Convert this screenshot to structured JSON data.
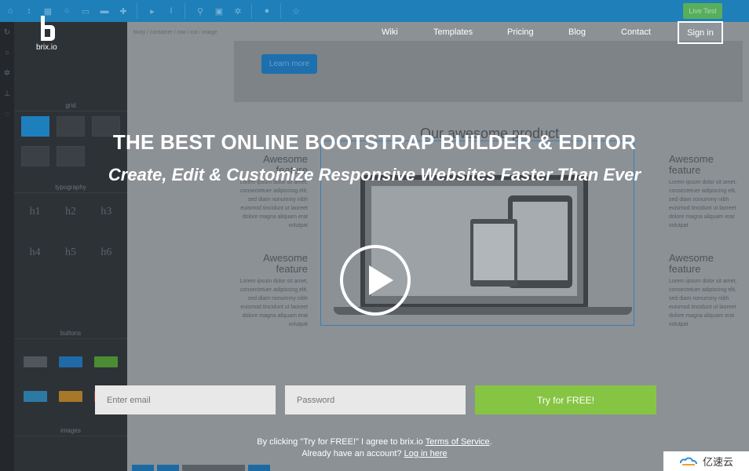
{
  "editor": {
    "toolbar_icons": [
      "home-icon",
      "arrows-icon",
      "grid-icon",
      "search-icon",
      "device-icon",
      "desktop-icon",
      "plus-icon",
      "pointer-icon",
      "text-icon",
      "zoom-icon",
      "image-icon",
      "gear-icon",
      "comment-icon",
      "star-icon"
    ],
    "live_test_label": "Live Test",
    "breadcrumb": "body / container / row / col / image",
    "learn_more_label": "Learn more",
    "product_title": "Our awesome product",
    "feature_heading": "Awesome feature",
    "feature_text": "Lorem ipsum dolor sit amet, consectetuer adipiscing elit, sed diam nonummy nibh euismod tincidunt ut laoreet dolore magna aliquam erat volutpat",
    "sidebar_sections": [
      "grid",
      "typography",
      "buttons",
      "images"
    ],
    "headings": [
      "h1",
      "h2",
      "h3",
      "h4",
      "h5",
      "h6"
    ]
  },
  "nav": {
    "logo_text": "brix.io",
    "links": [
      "Wiki",
      "Templates",
      "Pricing",
      "Blog",
      "Contact"
    ],
    "signin_label": "Sign in"
  },
  "hero": {
    "headline": "THE BEST ONLINE BOOTSTRAP BUILDER & EDITOR",
    "subheadline": "Create, Edit & Customize Responsive Websites Faster Than Ever"
  },
  "signup": {
    "email_placeholder": "Enter email",
    "password_placeholder": "Password",
    "cta_label": "Try for FREE!",
    "terms_prefix": "By clicking \"Try for FREE!\" I agree to brix.io ",
    "terms_link": "Terms of Service",
    "terms_suffix": ".",
    "login_prefix": "Already have an account? ",
    "login_link": "Log in here"
  },
  "watermark": {
    "text": "亿速云"
  },
  "colors": {
    "accent_green": "#86c543",
    "editor_blue": "#1f7fb8"
  }
}
